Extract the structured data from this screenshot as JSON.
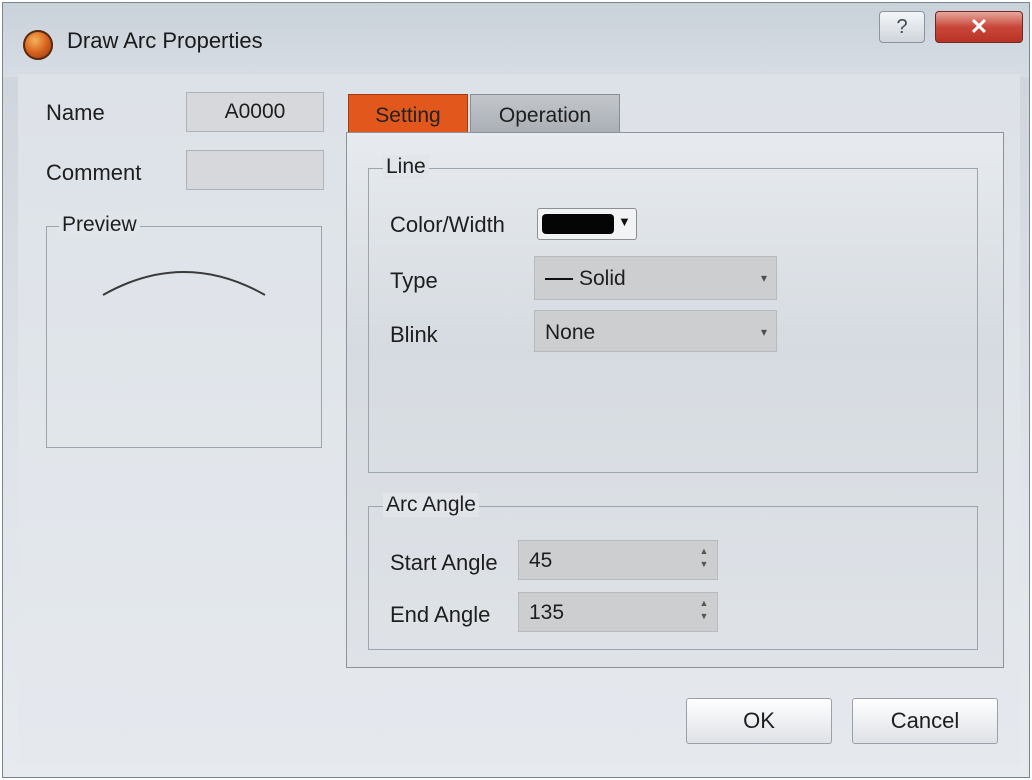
{
  "window": {
    "title": "Draw Arc Properties",
    "help_label": "?",
    "close_label": "✕"
  },
  "left": {
    "name_label": "Name",
    "name_value": "A0000",
    "comment_label": "Comment",
    "comment_value": "",
    "preview_label": "Preview"
  },
  "tabs": [
    {
      "label": "Setting",
      "active": true
    },
    {
      "label": "Operation",
      "active": false
    }
  ],
  "line_group": {
    "title": "Line",
    "color_width_label": "Color/Width",
    "color_value": "#000000",
    "type_label": "Type",
    "type_value": "Solid",
    "blink_label": "Blink",
    "blink_value": "None"
  },
  "arc_group": {
    "title": "Arc Angle",
    "start_label": "Start Angle",
    "start_value": "45",
    "end_label": "End Angle",
    "end_value": "135"
  },
  "footer": {
    "ok_label": "OK",
    "cancel_label": "Cancel"
  },
  "colors": {
    "active_tab": "#e2581c",
    "close_button": "#c9473a"
  }
}
